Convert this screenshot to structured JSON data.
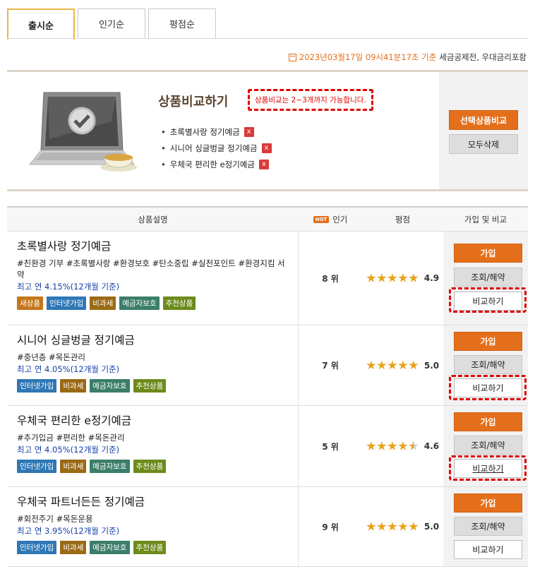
{
  "tabs": [
    {
      "label": "출시순",
      "active": true
    },
    {
      "label": "인기순",
      "active": false
    },
    {
      "label": "평점순",
      "active": false
    }
  ],
  "date_info": {
    "datetime": "2023년03월17일 09시41분17초 기준",
    "note": "세금공제전, 우대금리포함"
  },
  "compare": {
    "title": "상품비교하기",
    "warning": "상품비교는 2~3개까지 가능합니다.",
    "items": [
      "초록별사랑 정기예금",
      "시니어 싱글벙글 정기예금",
      "우체국 편리한 e정기예금"
    ],
    "remove_icon": "x",
    "compare_selected_label": "선택상품비교",
    "delete_all_label": "모두삭제"
  },
  "table": {
    "headers": {
      "desc": "상품설명",
      "hot": "HOT",
      "popularity": "인기",
      "rating": "평점",
      "action": "가입 및 비교"
    },
    "products": [
      {
        "name": "초록별사랑 정기예금",
        "tags": "#친환경 기부 #초록별사랑 #환경보호 #탄소중립 #실천포인트 #환경지킴 서약",
        "rate": "최고 연 4.15%(12개월 기준)",
        "badges": [
          "새상품",
          "인터넷가입",
          "비과세",
          "예금자보호",
          "추천상품"
        ],
        "rank": "8 위",
        "stars": 5,
        "score": "4.9"
      },
      {
        "name": "시니어 싱글벙글 정기예금",
        "tags": "#중년층 #목돈관리",
        "rate": "최고 연 4.05%(12개월 기준)",
        "badges": [
          "인터넷가입",
          "비과세",
          "예금자보호",
          "추천상품"
        ],
        "rank": "7 위",
        "stars": 5,
        "score": "5.0"
      },
      {
        "name": "우체국 편리한 e정기예금",
        "tags": "#추가입금 #편리한 #목돈관리",
        "rate": "최고 연 4.05%(12개월 기준)",
        "badges": [
          "인터넷가입",
          "비과세",
          "예금자보호",
          "추천상품"
        ],
        "rank": "5 위",
        "stars": 4.5,
        "score": "4.6"
      },
      {
        "name": "우체국 파트너든든 정기예금",
        "tags": "#회전주기 #목돈운용",
        "rate": "최고 연 3.95%(12개월 기준)",
        "badges": [
          "인터넷가입",
          "비과세",
          "예금자보호",
          "추천상품"
        ],
        "rank": "9 위",
        "stars": 5,
        "score": "5.0"
      }
    ],
    "buttons": {
      "join": "가입",
      "view": "조회/해약",
      "compare": "비교하기"
    }
  },
  "colors": {
    "accent": "#e46f1b",
    "highlight": "#e00000",
    "link_blue": "#1540a8"
  }
}
